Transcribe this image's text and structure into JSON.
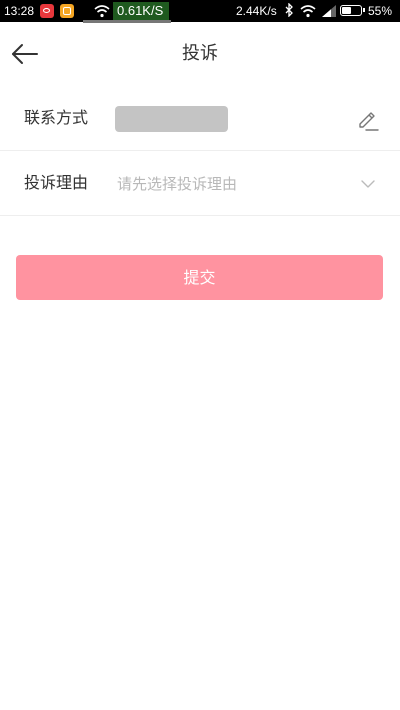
{
  "status_bar": {
    "time": "13:28",
    "speed_left": "0.61K/S",
    "speed_right": "2.44K/s",
    "battery_level": 0.55,
    "battery_text": "55%"
  },
  "header": {
    "title": "投诉",
    "back_icon": "arrow-left-icon"
  },
  "form": {
    "contact": {
      "label": "联系方式",
      "value": "",
      "edit_icon": "pencil-icon"
    },
    "reason": {
      "label": "投诉理由",
      "placeholder": "请先选择投诉理由",
      "dropdown_icon": "chevron-down-icon"
    }
  },
  "submit": {
    "label": "提交"
  },
  "colors": {
    "accent": "#ff93a0",
    "placeholder": "#b8b8b8",
    "divider": "#eeeeee"
  }
}
